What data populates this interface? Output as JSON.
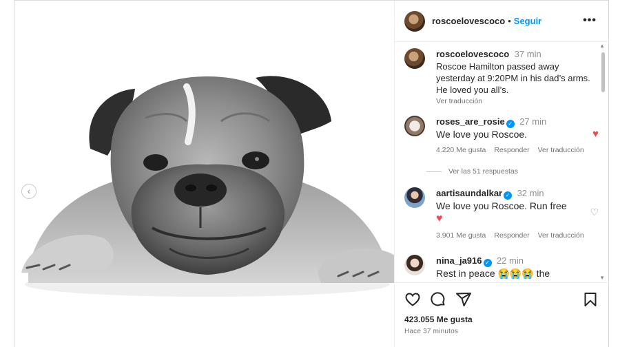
{
  "post": {
    "carousel": {
      "prev_icon": "chevron-left-icon",
      "prev_glyph": "‹"
    },
    "header": {
      "username": "roscoelovescoco",
      "separator": "•",
      "follow_label": "Seguir",
      "more_label": "•••"
    },
    "comments": [
      {
        "username": "roscoelovescoco",
        "time": "37 min",
        "text": "Roscoe Hamilton passed away yesterday at 9:20PM in his dad’s arms. He loved you all’s.",
        "translate": "Ver traducción"
      },
      {
        "username": "roses_are_rosie",
        "verified": "✓",
        "time": "27 min",
        "text": "We love you Roscoe.",
        "heart": "♥",
        "likes": "4.220 Me gusta",
        "reply": "Responder",
        "translate": "Ver traducción",
        "view_replies": "Ver las 51 respuestas"
      },
      {
        "username": "aartisaundalkar",
        "verified": "✓",
        "time": "32 min",
        "text": "We love you Roscoe. Run free",
        "emoji": "♥",
        "heart": "♡",
        "likes": "3.901 Me gusta",
        "reply": "Responder",
        "translate": "Ver traducción"
      },
      {
        "username": "nina_ja916",
        "verified": "✓",
        "time": "22 min",
        "text": "Rest in peace 😭😭😭 the"
      }
    ],
    "scroll": {
      "up": "▲",
      "down": "▼"
    },
    "actions": {
      "like_icon": "heart-outline-icon",
      "comment_icon": "comment-bubble-icon",
      "share_icon": "paper-plane-icon",
      "save_icon": "bookmark-icon"
    },
    "likes_count": "423.055 Me gusta",
    "posted_ago": "Hace 37 minutos",
    "colors": {
      "link": "#0095f6",
      "heart": "#ed4956",
      "verified": "#0095f6",
      "muted": "#737373"
    }
  }
}
